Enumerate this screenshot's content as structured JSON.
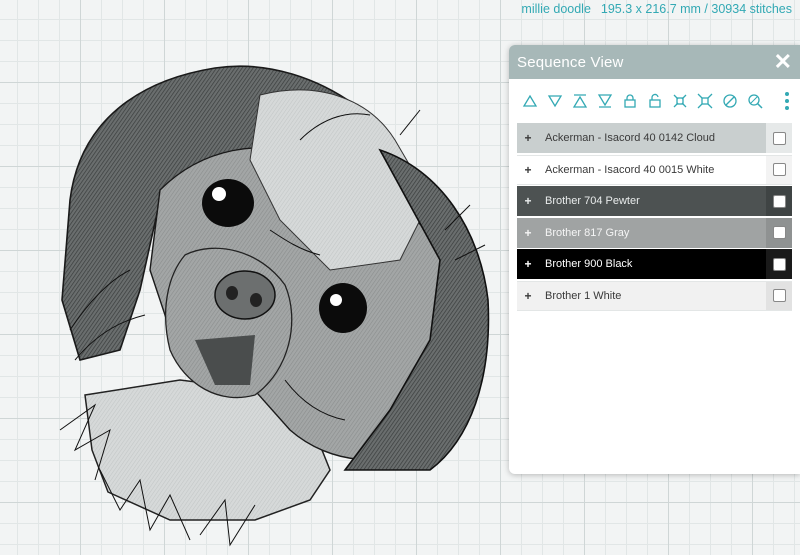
{
  "header": {
    "design_name": "millie doodle",
    "dimensions": "195.3 x 216.7 mm / 30934 stitches"
  },
  "sequence_panel": {
    "title": "Sequence View",
    "close_symbol": "✕",
    "toolbar": [
      {
        "name": "move-up-icon"
      },
      {
        "name": "move-down-icon"
      },
      {
        "name": "move-to-top-icon"
      },
      {
        "name": "move-to-bottom-icon"
      },
      {
        "name": "lock-icon"
      },
      {
        "name": "unlock-icon"
      },
      {
        "name": "group-icon"
      },
      {
        "name": "ungroup-icon"
      },
      {
        "name": "hide-icon"
      },
      {
        "name": "find-icon"
      }
    ],
    "more_icon": "more-vertical-icon",
    "threads": [
      {
        "label": "Ackerman - Isacord 40 0142 Cloud",
        "color": "#c9cfcf",
        "text_color": "#3a3a3a",
        "checkbox_bg": "#e6e9e9"
      },
      {
        "label": "Ackerman - Isacord 40 0015 White",
        "color": "#ffffff",
        "text_color": "#3a3a3a",
        "checkbox_bg": "#f3f3f3"
      },
      {
        "label": "Brother 704 Pewter",
        "color": "#4d5252",
        "text_color": "#e9ecec",
        "checkbox_bg": "#3f4444"
      },
      {
        "label": "Brother 817 Gray",
        "color": "#a0a3a3",
        "text_color": "#f5f5f5",
        "checkbox_bg": "#8f9292"
      },
      {
        "label": "Brother 900 Black",
        "color": "#000000",
        "text_color": "#ffffff",
        "checkbox_bg": "#1a1a1a"
      },
      {
        "label": "Brother 1 White",
        "color": "#f1f1f1",
        "text_color": "#3a3a3a",
        "checkbox_bg": "#e2e2e2"
      }
    ]
  },
  "colors": {
    "accent": "#33a9b4",
    "panel_header": "#a7b8b8"
  }
}
